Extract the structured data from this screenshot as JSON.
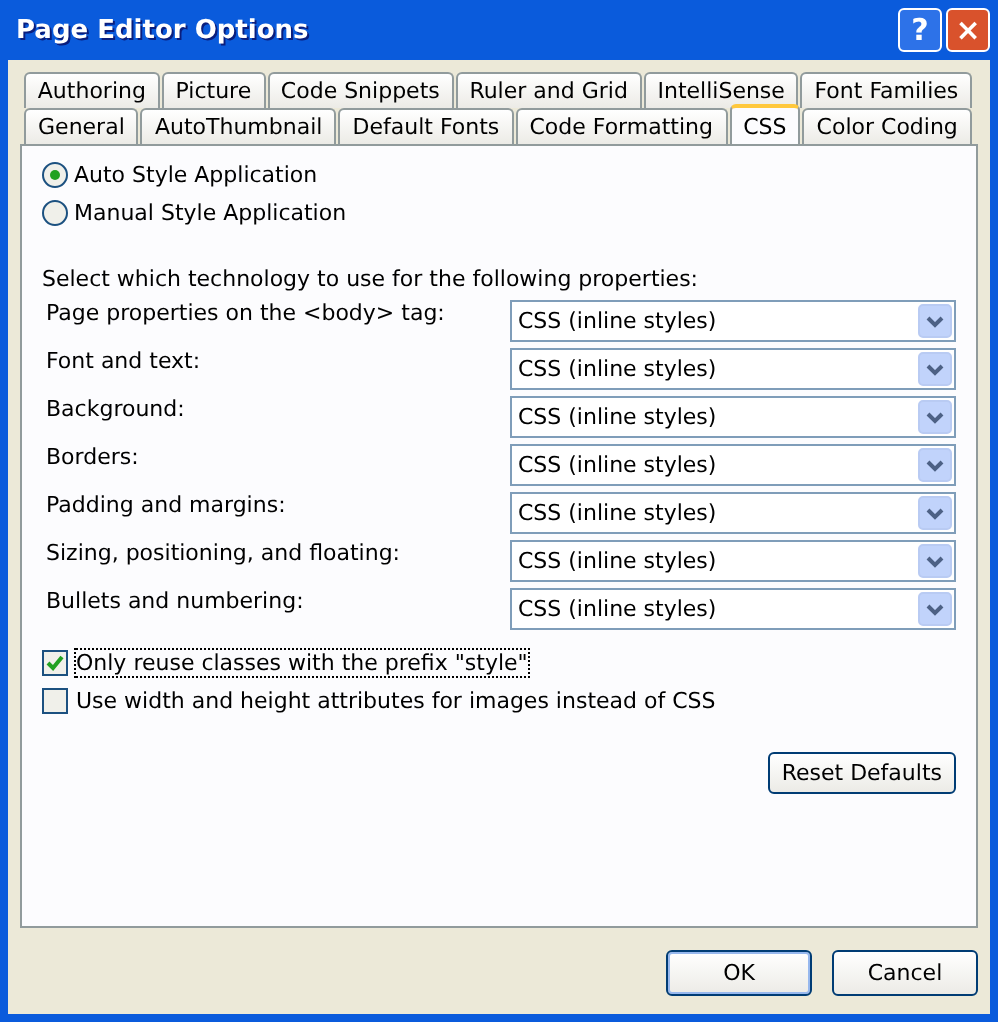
{
  "window": {
    "title": "Page Editor Options",
    "help_button": "?",
    "close_button": "×"
  },
  "tab_rows": [
    [
      {
        "label": "Authoring",
        "selected": false
      },
      {
        "label": "Picture",
        "selected": false
      },
      {
        "label": "Code Snippets",
        "selected": false
      },
      {
        "label": "Ruler and Grid",
        "selected": false
      },
      {
        "label": "IntelliSense",
        "selected": false
      },
      {
        "label": "Font Families",
        "selected": false
      }
    ],
    [
      {
        "label": "General",
        "selected": false
      },
      {
        "label": "AutoThumbnail",
        "selected": false
      },
      {
        "label": "Default Fonts",
        "selected": false
      },
      {
        "label": "Code Formatting",
        "selected": false
      },
      {
        "label": "CSS",
        "selected": true
      },
      {
        "label": "Color Coding",
        "selected": false
      }
    ]
  ],
  "radios": [
    {
      "label": "Auto Style Application",
      "selected": true
    },
    {
      "label": "Manual Style Application",
      "selected": false
    }
  ],
  "instruction": "Select which technology to use for the following properties:",
  "properties": [
    {
      "label": "Page properties on the <body> tag:",
      "value": "CSS (inline styles)"
    },
    {
      "label": "Font and text:",
      "value": "CSS (inline styles)"
    },
    {
      "label": "Background:",
      "value": "CSS (inline styles)"
    },
    {
      "label": "Borders:",
      "value": "CSS (inline styles)"
    },
    {
      "label": "Padding and margins:",
      "value": "CSS (inline styles)"
    },
    {
      "label": "Sizing, positioning, and floating:",
      "value": "CSS (inline styles)"
    },
    {
      "label": "Bullets and numbering:",
      "value": "CSS (inline styles)"
    }
  ],
  "checkboxes": [
    {
      "label": "Only reuse classes with the prefix \"style\"",
      "checked": true,
      "focused": true
    },
    {
      "label": "Use width and height attributes for images instead of CSS",
      "checked": false,
      "focused": false
    }
  ],
  "reset_button": "Reset Defaults",
  "buttons": [
    {
      "label": "OK",
      "default": true
    },
    {
      "label": "Cancel",
      "default": false
    }
  ]
}
